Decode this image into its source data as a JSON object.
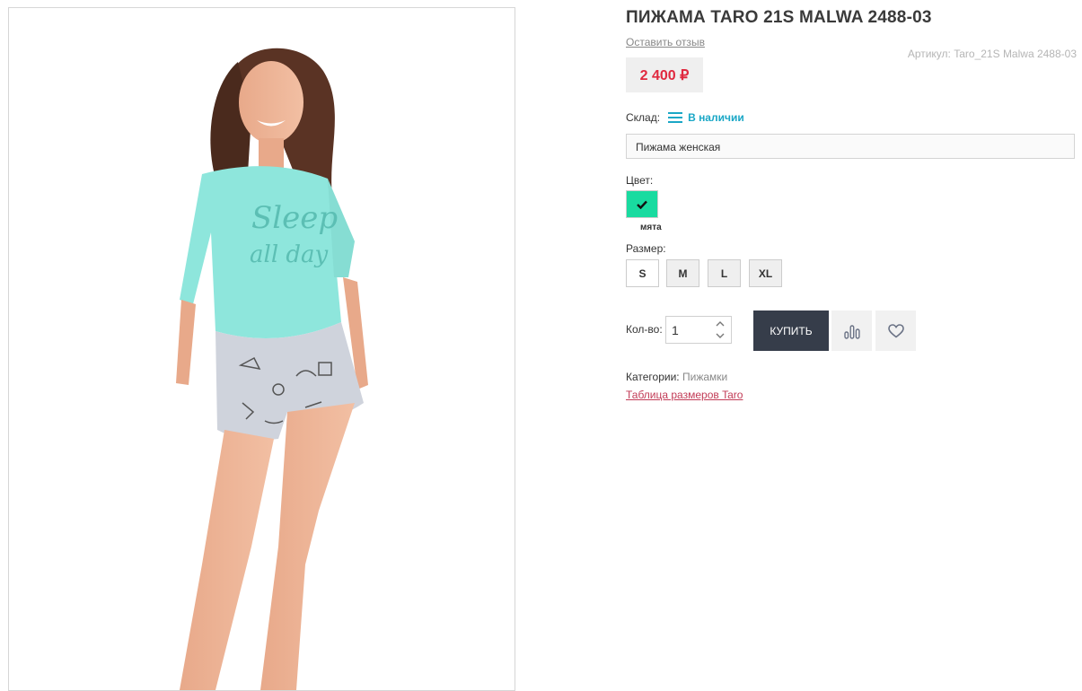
{
  "product": {
    "title": "ПИЖАМА TARO 21S MALWA 2488-03",
    "review_link": "Оставить отзыв",
    "sku_label": "Артикул:",
    "sku_value": "Taro_21S Malwa 2488-03",
    "price": "2 400 ₽"
  },
  "stock": {
    "label": "Склад:",
    "value": "В наличии"
  },
  "description": "Пижама женская",
  "color": {
    "label": "Цвет:",
    "selected_name": "мята",
    "swatch_hex": "#19dba0"
  },
  "size": {
    "label": "Размер:",
    "options": [
      "S",
      "M",
      "L",
      "XL"
    ],
    "selected": "S"
  },
  "quantity": {
    "label": "Кол-во:",
    "value": "1"
  },
  "actions": {
    "buy_label": "КУПИТЬ",
    "compare_icon": "compare-bars-icon",
    "wishlist_icon": "heart-icon"
  },
  "meta": {
    "categories_label": "Категории:",
    "categories_value": "Пижамки",
    "size_table_link": "Таблица размеров Taro"
  },
  "colors": {
    "accent": "#e0293f",
    "stock": "#1aa7c6",
    "buy_button": "#363d4a",
    "link": "#c23b56"
  }
}
